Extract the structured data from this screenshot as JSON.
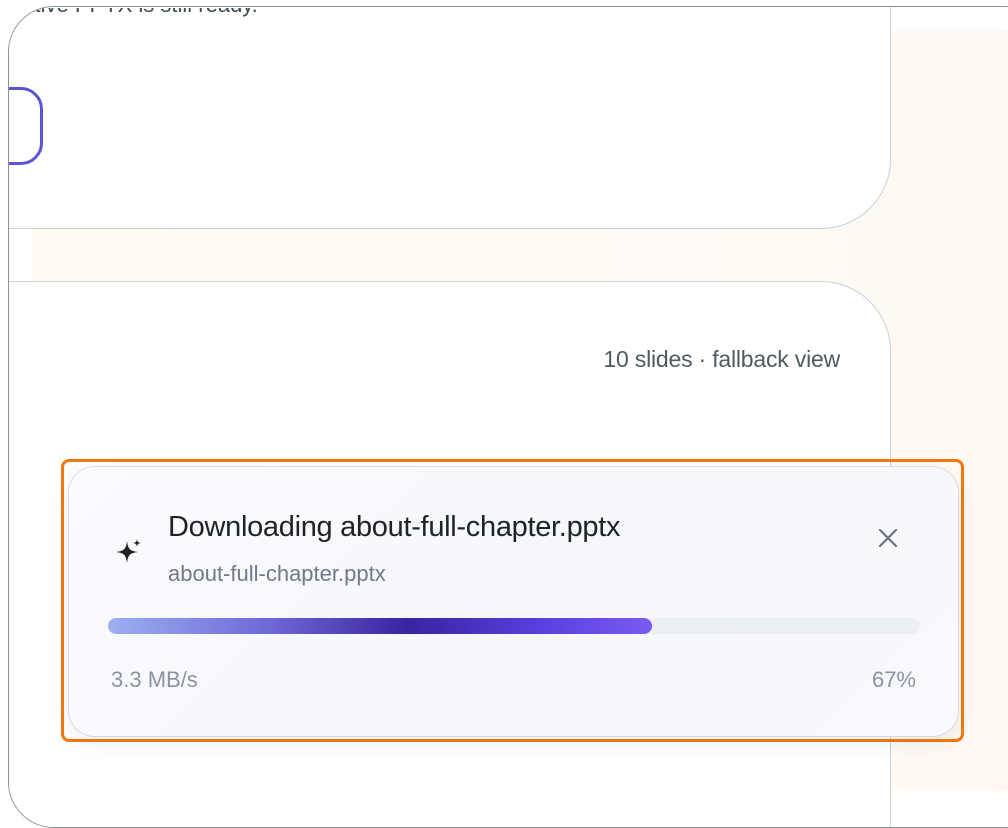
{
  "background": {
    "top_card_text": "is native PPTX is still ready.",
    "slides_meta": "10 slides · fallback view"
  },
  "toast": {
    "icon": "sparkle-icon",
    "title": "Downloading about-full-chapter.pptx",
    "filename": "about-full-chapter.pptx",
    "close_icon": "close-icon",
    "progress": 0.67,
    "speed": "3.3 MB/s",
    "percent_label": "67%"
  },
  "colors": {
    "highlight": "#f07a12",
    "accent": "#5b55d6",
    "progress_track": "#eceff3"
  }
}
